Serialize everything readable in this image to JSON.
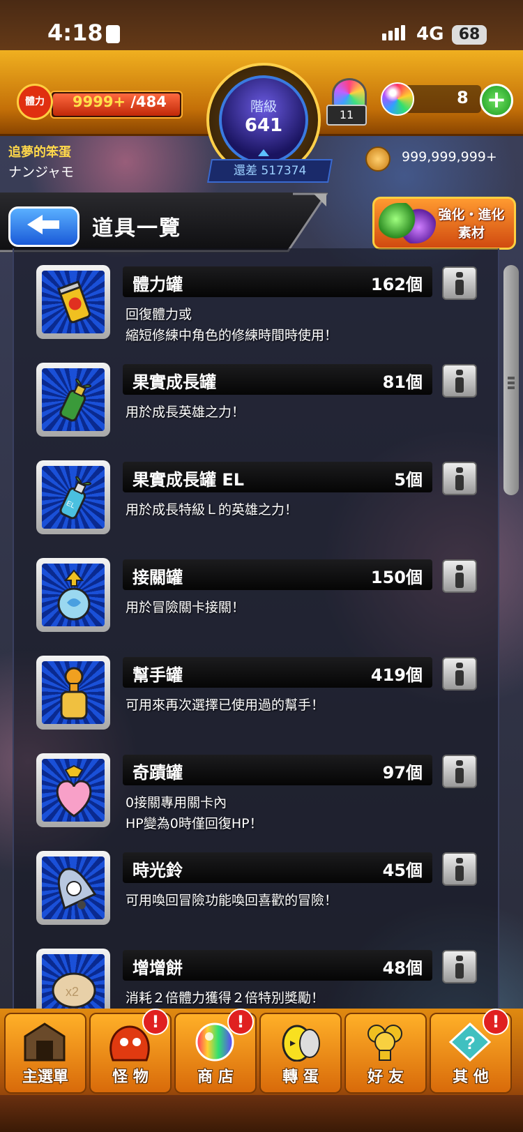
{
  "status": {
    "time": "4:18",
    "network": "4G",
    "battery": "68"
  },
  "header": {
    "stamina_icon_label": "體力",
    "stamina_current": "9999+",
    "stamina_max": "/484",
    "stamina_fill_fraction": 1.0,
    "rank_label": "階級",
    "rank_value": "641",
    "rank_diff": "還差 517374",
    "orb_machine_count": "11",
    "orb_count": "8",
    "plus_label": "+",
    "player_title": "追夢的笨蛋",
    "player_name": "ナンジャモ",
    "coins": "999,999,999+"
  },
  "page": {
    "title": "道具一覽",
    "evolution_button": "強化・進化 素材"
  },
  "items": [
    {
      "name": "體力罐",
      "qty": "162個",
      "desc": "回復體力或\n縮短修練中角色的修練時間時使用！",
      "icon": "stamina-can-icon"
    },
    {
      "name": "果實成長罐",
      "qty": "81個",
      "desc": "用於成長英雄之力！",
      "icon": "fruit-growth-can-icon"
    },
    {
      "name": "果實成長罐 EL",
      "qty": "5個",
      "desc": "用於成長特級Ｌ的英雄之力！",
      "icon": "fruit-growth-can-el-icon"
    },
    {
      "name": "接關罐",
      "qty": "150個",
      "desc": "用於冒險關卡接關！",
      "icon": "continue-can-icon"
    },
    {
      "name": "幫手罐",
      "qty": "419個",
      "desc": "可用來再次選擇已使用過的幫手！",
      "icon": "helper-can-icon"
    },
    {
      "name": "奇蹟罐",
      "qty": "97個",
      "desc": "0接關專用關卡內\nHP變為0時僅回復HP！",
      "icon": "miracle-can-icon"
    },
    {
      "name": "時光鈴",
      "qty": "45個",
      "desc": "可用喚回冒險功能喚回喜歡的冒險！",
      "icon": "time-bell-icon"
    },
    {
      "name": "增增餅",
      "qty": "48個",
      "desc": "消耗２倍體力獲得２倍特別獎勵！",
      "icon": "double-cookie-icon"
    }
  ],
  "nav": [
    {
      "label": "主選單",
      "icon": "home-gate-icon",
      "alert": false
    },
    {
      "label": "怪 物",
      "icon": "monster-icon",
      "alert": true
    },
    {
      "label": "商 店",
      "icon": "orb-shop-icon",
      "alert": true
    },
    {
      "label": "轉 蛋",
      "icon": "egg-gacha-icon",
      "alert": false
    },
    {
      "label": "好 友",
      "icon": "friends-icon",
      "alert": false
    },
    {
      "label": "其 他",
      "icon": "other-icon",
      "alert": true
    }
  ],
  "alert_glyph": "!",
  "colors": {
    "accent_gold": "#f0b020",
    "item_icon_blue": "#1a50d8",
    "plus_green": "#1a9a20",
    "alert_red": "#e02020"
  }
}
